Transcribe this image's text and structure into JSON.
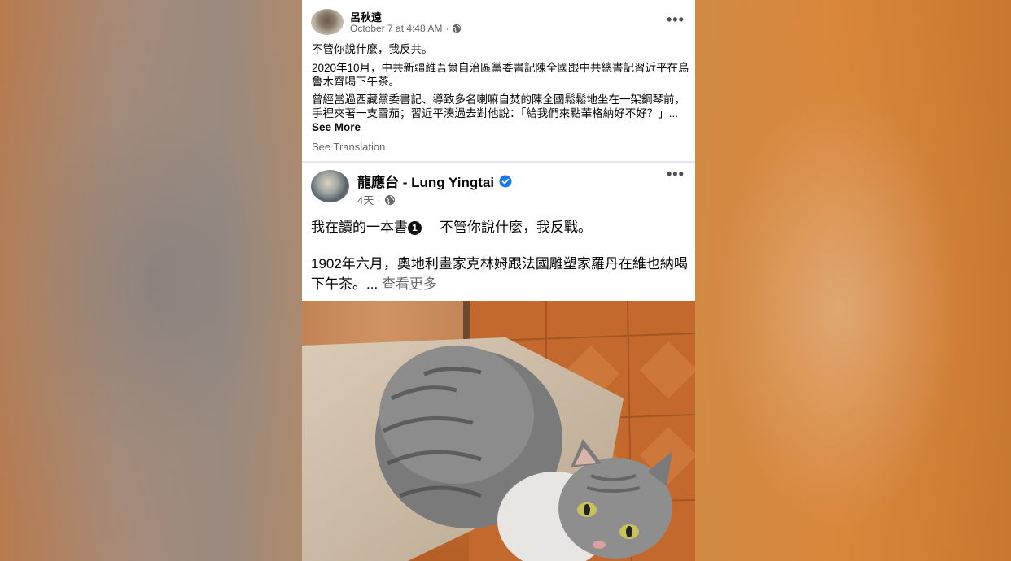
{
  "post1": {
    "author": "呂秋遠",
    "timestamp": "October 7 at 4:48 AM",
    "dot": "·",
    "paragraphs": [
      "不管你說什麼，我反共。",
      "2020年10月，中共新疆維吾爾自治區黨委書記陳全國跟中共總書記習近平在烏魯木齊喝下午茶。",
      "曾經當過西藏黨委書記、導致多名喇嘛自焚的陳全國鬆鬆地坐在一架鋼琴前，手裡夾著一支雪茄；習近平湊過去對他說：「給我們來點華格納好不好？」..."
    ],
    "see_more": "See More",
    "see_translation": "See Translation",
    "more_label": "•••"
  },
  "post2": {
    "author": "龍應台 - Lung Yingtai",
    "timestamp": "4天",
    "dot": "·",
    "line1_a": "我在讀的一本書",
    "badge": "1",
    "line1_b": "不管你說什麼，我反戰。",
    "line2": "1902年六月，奧地利畫家克林姆跟法國雕塑家羅丹在維也納喝下午茶。...",
    "see_more": "查看更多",
    "more_label": "•••"
  },
  "colors": {
    "verified": "#1877f2",
    "secondary_text": "#65676b",
    "primary_text": "#050505"
  },
  "icons": [
    "globe-icon",
    "verified-badge-icon",
    "more-options-icon"
  ]
}
